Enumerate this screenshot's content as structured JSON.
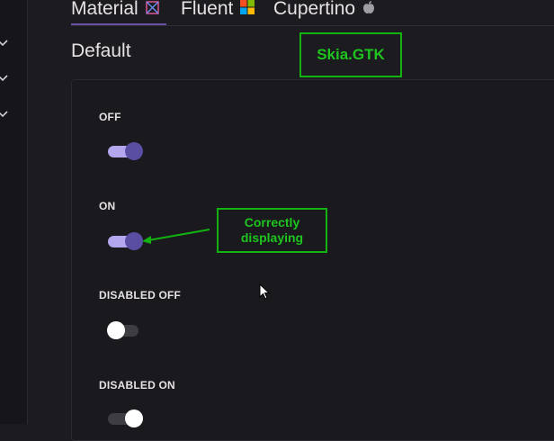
{
  "tabs": [
    {
      "label": "Material",
      "icon": "material-logo-icon"
    },
    {
      "label": "Fluent",
      "icon": "windows-logo-icon"
    },
    {
      "label": "Cupertino",
      "icon": "apple-logo-icon"
    }
  ],
  "page_title": "Default",
  "annotations": {
    "skia": "Skia.GTK",
    "correct": "Correctly displaying"
  },
  "toggles": [
    {
      "label": "OFF",
      "state": "on",
      "enabled": true
    },
    {
      "label": "ON",
      "state": "on",
      "enabled": true
    },
    {
      "label": "DISABLED OFF",
      "state": "off",
      "enabled": false
    },
    {
      "label": "DISABLED ON",
      "state": "on",
      "enabled": false
    }
  ],
  "colors": {
    "background": "#1c1b1f",
    "accent": "#6750a4",
    "track_on": "#b4a7ee",
    "thumb_on": "#5a4ea3",
    "annotation": "#12b212"
  }
}
